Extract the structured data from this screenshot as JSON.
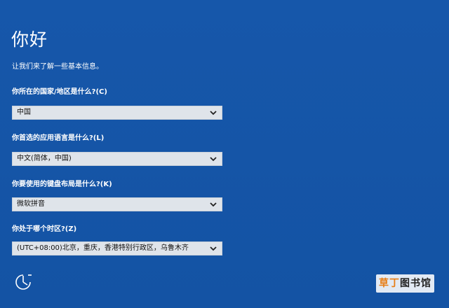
{
  "title": "你好",
  "subtitle": "让我们来了解一些基本信息。",
  "fields": [
    {
      "label": "你所在的国家/地区是什么?(C)",
      "value": "中国"
    },
    {
      "label": "你首选的应用语言是什么?(L)",
      "value": "中文(简体，中国)"
    },
    {
      "label": "你要使用的键盘布局是什么?(K)",
      "value": "微软拼音"
    },
    {
      "label": "你处于哪个时区?(Z)",
      "value": "(UTC+08:00)北京，重庆，香港特别行政区，乌鲁木齐"
    }
  ],
  "ease_of_access_icon": "ease-of-access-icon",
  "watermark": {
    "part1": "草丁",
    "part2": "图书馆"
  },
  "colors": {
    "background": "#1556a9",
    "select_bg": "#dfe4ea",
    "text": "#ffffff",
    "watermark_orange": "#e77d14"
  }
}
